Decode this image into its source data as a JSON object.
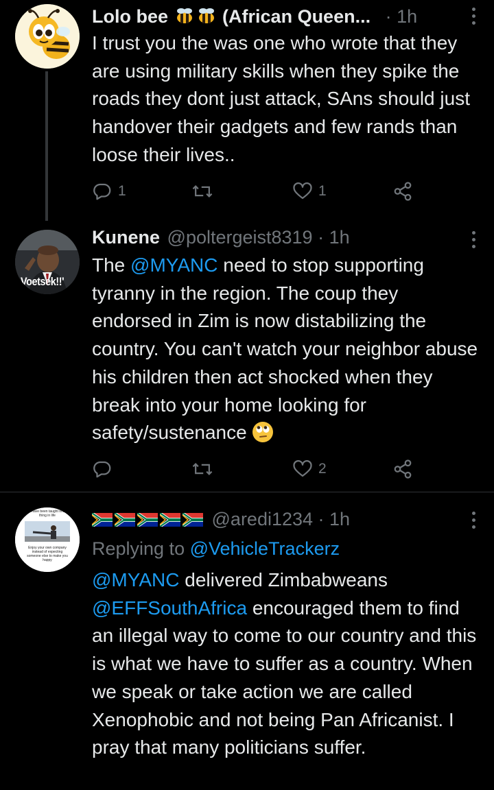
{
  "tweets": [
    {
      "name": "Lolo bee",
      "name_suffix": "(African Queen...",
      "handle": "",
      "time": "· 1h",
      "body": "I trust you the was one who wrote that they are using military skills when they spike the roads they dont just attack, SAns should just handover their gadgets and few rands than loose their lives..",
      "replies": "1",
      "retweets": "",
      "likes": "1",
      "avatar_icon": "bee-avatar"
    },
    {
      "name": "Kunene",
      "handle": "@poltergeist8319",
      "time": "· 1h",
      "body_parts": {
        "pre": "The ",
        "mention": "@MYANC",
        "post": "  need to stop supporting tyranny in the region. The coup they endorsed in Zim is now distabilizing the country. You can't watch your neighbor abuse his children then act shocked when they break into your home looking for safety/sustenance "
      },
      "avatar_caption": "Voetsek!!'",
      "replies": "",
      "retweets": "",
      "likes": "2",
      "emoji": "face-with-rolling-eyes"
    },
    {
      "name": "",
      "handle": "@aredi1234",
      "time": "· 1h",
      "replying_label": "Replying to ",
      "replying_to": "@VehicleTrackerz",
      "body_parts": {
        "m1": "@MYANC",
        "t1": " delivered Zimbabweans ",
        "m2": "@EFFSouthAfrica",
        "t2": " encouraged them to find an illegal way to come to our country and this is what we have to suffer as a country. When we speak or take action we are called Xenophobic and not being Pan Africanist. I pray that many politicians suffer."
      },
      "avatar_text": {
        "top": "I have been taught one thing in life",
        "bottom": "Enjoy your own company instead of expecting someone else to make you happy"
      },
      "flags": 5
    }
  ],
  "colors": {
    "background": "#000000",
    "text": "#e7e9ea",
    "muted": "#71767b",
    "link": "#1d9bf0",
    "divider": "#2f3336"
  }
}
